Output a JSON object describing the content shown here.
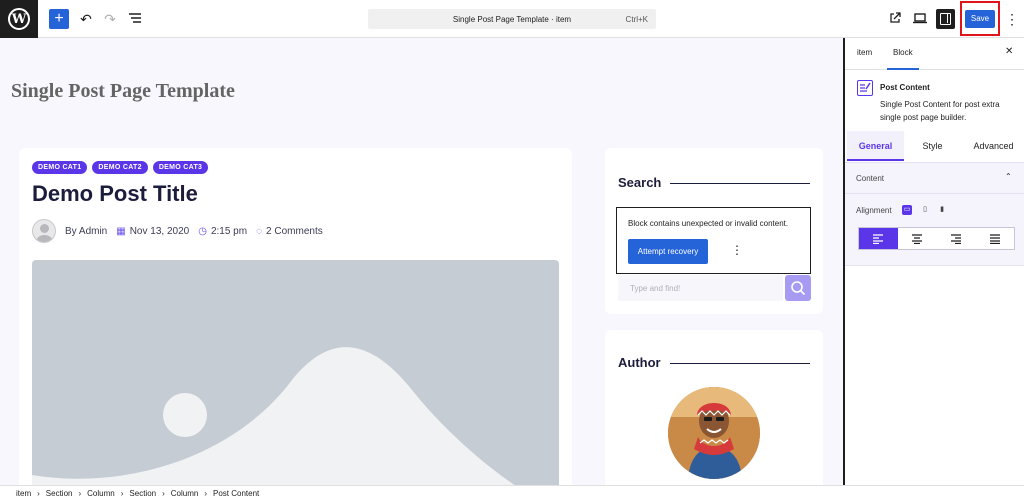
{
  "toolbar": {
    "command_bar_title": "Single Post Page Template · item",
    "command_bar_shortcut": "Ctrl+K",
    "save_label": "Save"
  },
  "canvas": {
    "page_title": "Single Post Page Template",
    "post": {
      "categories": [
        "DEMO CAT1",
        "DEMO CAT2",
        "DEMO CAT3"
      ],
      "title": "Demo Post Title",
      "author": "By Admin",
      "date": "Nov 13, 2020",
      "time": "2:15 pm",
      "comments": "2 Comments"
    },
    "search_widget": {
      "title": "Search",
      "error_message": "Block contains unexpected or invalid content.",
      "recovery_button": "Attempt recovery",
      "placeholder": "Type and find!"
    },
    "author_widget": {
      "title": "Author"
    }
  },
  "panel": {
    "tabs": [
      "item",
      "Block"
    ],
    "block_name": "Post Content",
    "block_description": "Single Post Content for post extra single post page builder.",
    "style_tabs": [
      "General",
      "Style",
      "Advanced"
    ],
    "section_title": "Content",
    "alignment_label": "Alignment"
  },
  "breadcrumb": [
    "item",
    "Section",
    "Column",
    "Section",
    "Column",
    "Post Content"
  ],
  "colors": {
    "accent": "#5b36e8",
    "wp_blue": "#2563d9",
    "highlight_red": "#e0151c"
  }
}
